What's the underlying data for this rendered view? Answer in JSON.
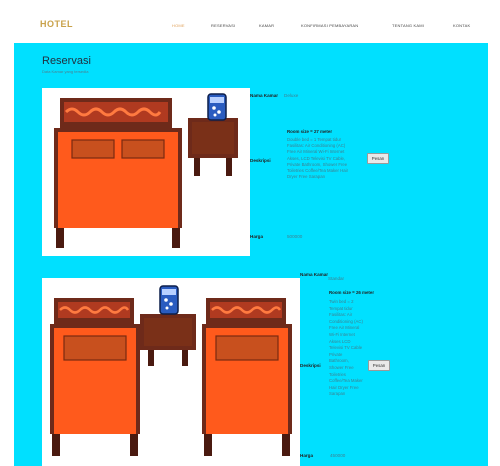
{
  "brand": "HOTEL",
  "nav": [
    {
      "label": "HOME",
      "active": true
    },
    {
      "label": "RESERVASI",
      "active": false
    },
    {
      "label": "KAMAR",
      "active": false
    },
    {
      "label": "KONFIRMASI PEMBAYARAN",
      "active": false
    },
    {
      "label": "TENTANG KAMI",
      "active": false
    },
    {
      "label": "KONTAK",
      "active": false
    }
  ],
  "page": {
    "title": "Reservasi",
    "subtitle": "Data Kamar yang tersedia"
  },
  "labels": {
    "room_name": "Nama Kamar",
    "description": "Deskripsi",
    "price": "Harga",
    "book": "Pesan"
  },
  "rooms": [
    {
      "name": "Deluxe",
      "size": "Room size = 27 meter",
      "description_lines": [
        "Double bed = 1 Tempat tidur",
        "Fasilitas: Air Conditioning (AC)",
        "Free Air Mineral Wi-Fi Internet",
        "Akses, LCD Televisi TV Cable,",
        "Private Bathroom, Shower Free",
        "Toiletries Coffee/Tea Maker Hair",
        "Dryer Free Sarapan"
      ],
      "price": "500000"
    },
    {
      "name": "Standar",
      "size": "Room size = 26 meter",
      "description_lines": [
        "Twin bed = 2",
        "Tempat tidur",
        "Fasilitas: Air",
        "Conditioning (AC)",
        "Free Air Mineral",
        "Wi-Fi Internet",
        "Akses LCD",
        "Televisi TV Cable",
        "Private",
        "Bathroom,",
        "Shower Free",
        "Toiletries",
        "Coffee/Tea Maker",
        "Hair Dryer Free",
        "Sarapan"
      ],
      "price": "450000"
    }
  ],
  "colors": {
    "content_bg": "#00e0ff",
    "brand": "#c9a24a",
    "bed_frame": "#6e2a1a",
    "mattress": "#ff5a1c"
  }
}
